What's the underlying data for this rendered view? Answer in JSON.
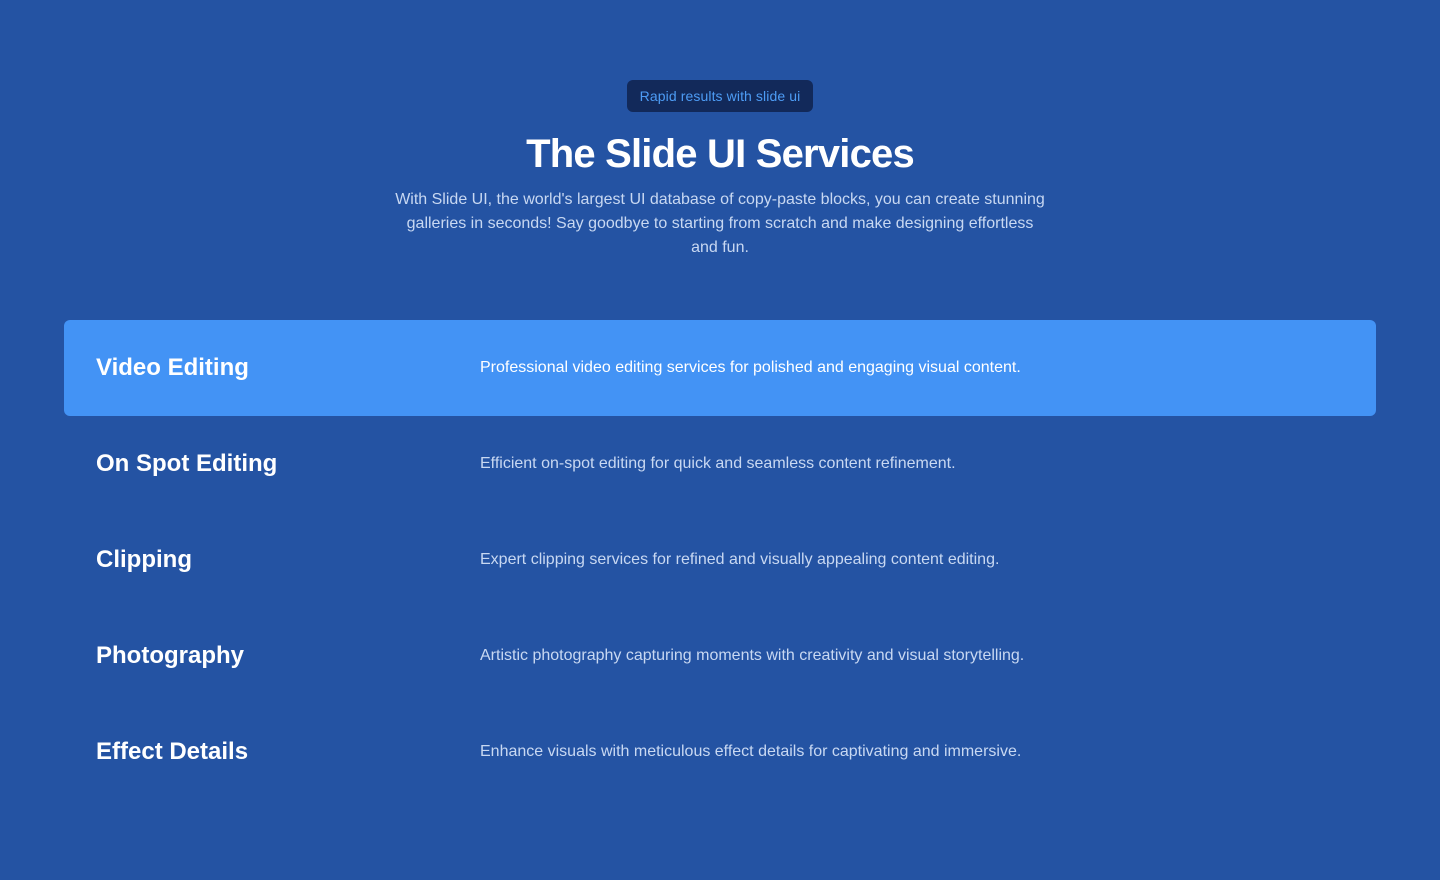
{
  "hero": {
    "badge": "Rapid results with slide ui",
    "title": "The Slide UI Services",
    "subtitle": "With Slide UI, the world's largest UI database of copy-paste blocks, you can create stunning galleries in seconds! Say goodbye to starting from scratch and make designing effortless and fun."
  },
  "services": {
    "active_index": 0,
    "items": [
      {
        "name": "Video Editing",
        "description": "Professional video editing services for polished and engaging visual content."
      },
      {
        "name": "On Spot Editing",
        "description": "Efficient on-spot editing for quick and seamless content refinement."
      },
      {
        "name": "Clipping",
        "description": "Expert clipping services for refined and visually appealing content editing."
      },
      {
        "name": "Photography",
        "description": "Artistic photography capturing moments with creativity and visual storytelling."
      },
      {
        "name": "Effect Details",
        "description": "Enhance visuals with meticulous effect details for captivating and immersive."
      }
    ]
  },
  "colors": {
    "background": "#2453a3",
    "active_row": "#4393f5",
    "badge_bg": "#12295a",
    "badge_text": "#4d9cf5"
  }
}
